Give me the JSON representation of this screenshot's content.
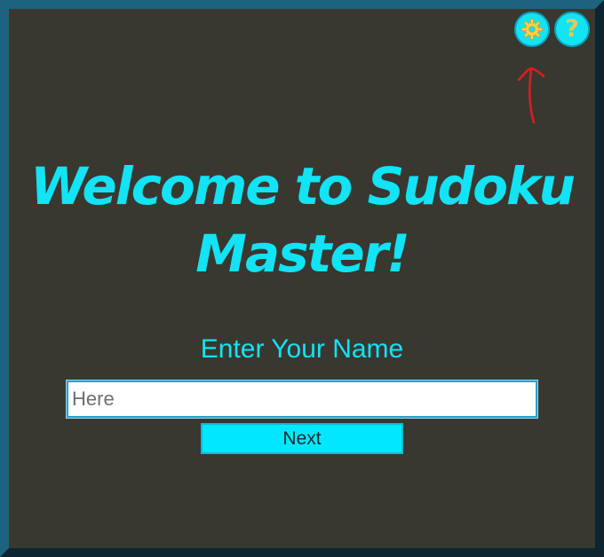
{
  "toolbar": {
    "settings_icon": "gear-icon",
    "help_icon": "question-mark-icon",
    "help_glyph": "?",
    "annotation_icon": "red-arrow-icon"
  },
  "welcome": {
    "title": "Welcome to Sudoku Master!",
    "prompt": "Enter Your Name"
  },
  "form": {
    "name_placeholder": "Here",
    "name_value": "",
    "next_label": "Next"
  },
  "colors": {
    "background": "#383830",
    "accent": "#12e3f5",
    "icon": "#e9c84a",
    "annotation": "#d41f1f"
  }
}
